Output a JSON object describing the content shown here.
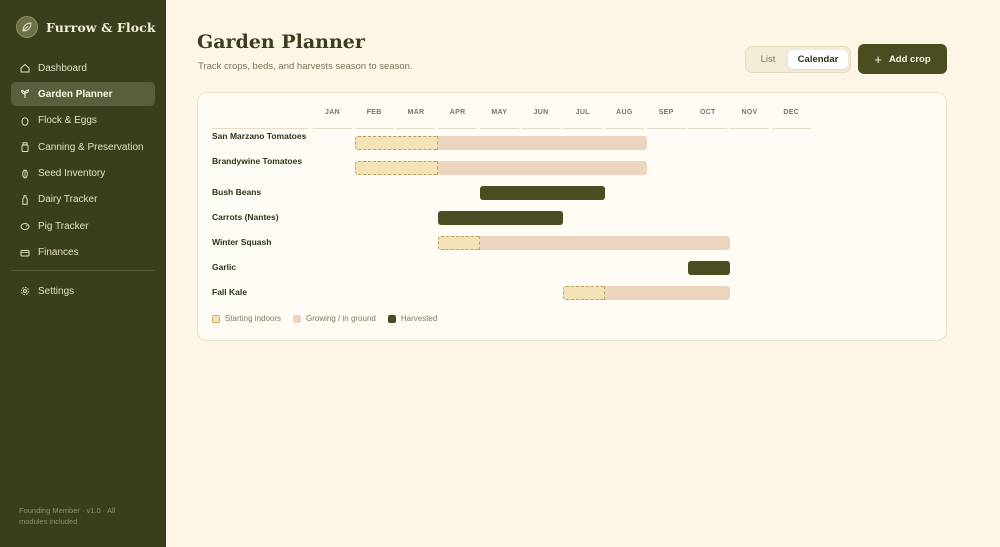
{
  "app": {
    "name": "Furrow & Flock"
  },
  "sidebar": {
    "items": [
      {
        "label": "Dashboard",
        "icon": "home-icon"
      },
      {
        "label": "Garden Planner",
        "icon": "sprout-icon",
        "active": true
      },
      {
        "label": "Flock & Eggs",
        "icon": "egg-icon"
      },
      {
        "label": "Canning & Preservation",
        "icon": "jar-icon"
      },
      {
        "label": "Seed Inventory",
        "icon": "seed-icon"
      },
      {
        "label": "Dairy Tracker",
        "icon": "milk-bottle-icon"
      },
      {
        "label": "Pig Tracker",
        "icon": "pig-icon"
      },
      {
        "label": "Finances",
        "icon": "wallet-icon"
      }
    ],
    "settings": {
      "label": "Settings",
      "icon": "gear-icon"
    },
    "footer": "Founding Member · v1.0 · All modules included"
  },
  "header": {
    "title": "Garden Planner",
    "subtitle": "Track crops, beds, and harvests season to season.",
    "view_toggle": {
      "list": "List",
      "calendar": "Calendar",
      "selected": "Calendar"
    },
    "add_button": "Add crop"
  },
  "planner": {
    "months": [
      "JAN",
      "FEB",
      "MAR",
      "APR",
      "MAY",
      "JUN",
      "JUL",
      "AUG",
      "SEP",
      "OCT",
      "NOV",
      "DEC"
    ],
    "crops": [
      {
        "name": "San Marzano Tomatoes",
        "phases": [
          {
            "type": "starting",
            "start": 2,
            "end": 4
          },
          {
            "type": "growing",
            "start": 4,
            "end": 9
          }
        ]
      },
      {
        "name": "Brandywine Tomatoes",
        "phases": [
          {
            "type": "starting",
            "start": 2,
            "end": 4
          },
          {
            "type": "growing",
            "start": 4,
            "end": 9
          }
        ]
      },
      {
        "name": "Bush Beans",
        "phases": [
          {
            "type": "harvested",
            "start": 5,
            "end": 8
          }
        ]
      },
      {
        "name": "Carrots (Nantes)",
        "phases": [
          {
            "type": "harvested",
            "start": 4,
            "end": 7
          }
        ]
      },
      {
        "name": "Winter Squash",
        "phases": [
          {
            "type": "starting",
            "start": 4,
            "end": 5
          },
          {
            "type": "growing",
            "start": 5,
            "end": 11
          }
        ]
      },
      {
        "name": "Garlic",
        "phases": [
          {
            "type": "harvested",
            "start": 10,
            "end": 11
          }
        ]
      },
      {
        "name": "Fall Kale",
        "phases": [
          {
            "type": "starting",
            "start": 7,
            "end": 8
          },
          {
            "type": "growing",
            "start": 8,
            "end": 11
          }
        ]
      }
    ],
    "legend": [
      {
        "type": "starting",
        "label": "Starting indoors"
      },
      {
        "type": "growing",
        "label": "Growing / in ground"
      },
      {
        "type": "harvested",
        "label": "Harvested"
      }
    ]
  },
  "colors": {
    "sidebar_bg": "#3b3e1d",
    "accent": "#4a4c22",
    "page_bg": "#fdf6e7",
    "starting": "#f3e3b6",
    "growing": "#ecd4be",
    "harvested": "#4a4c22"
  }
}
